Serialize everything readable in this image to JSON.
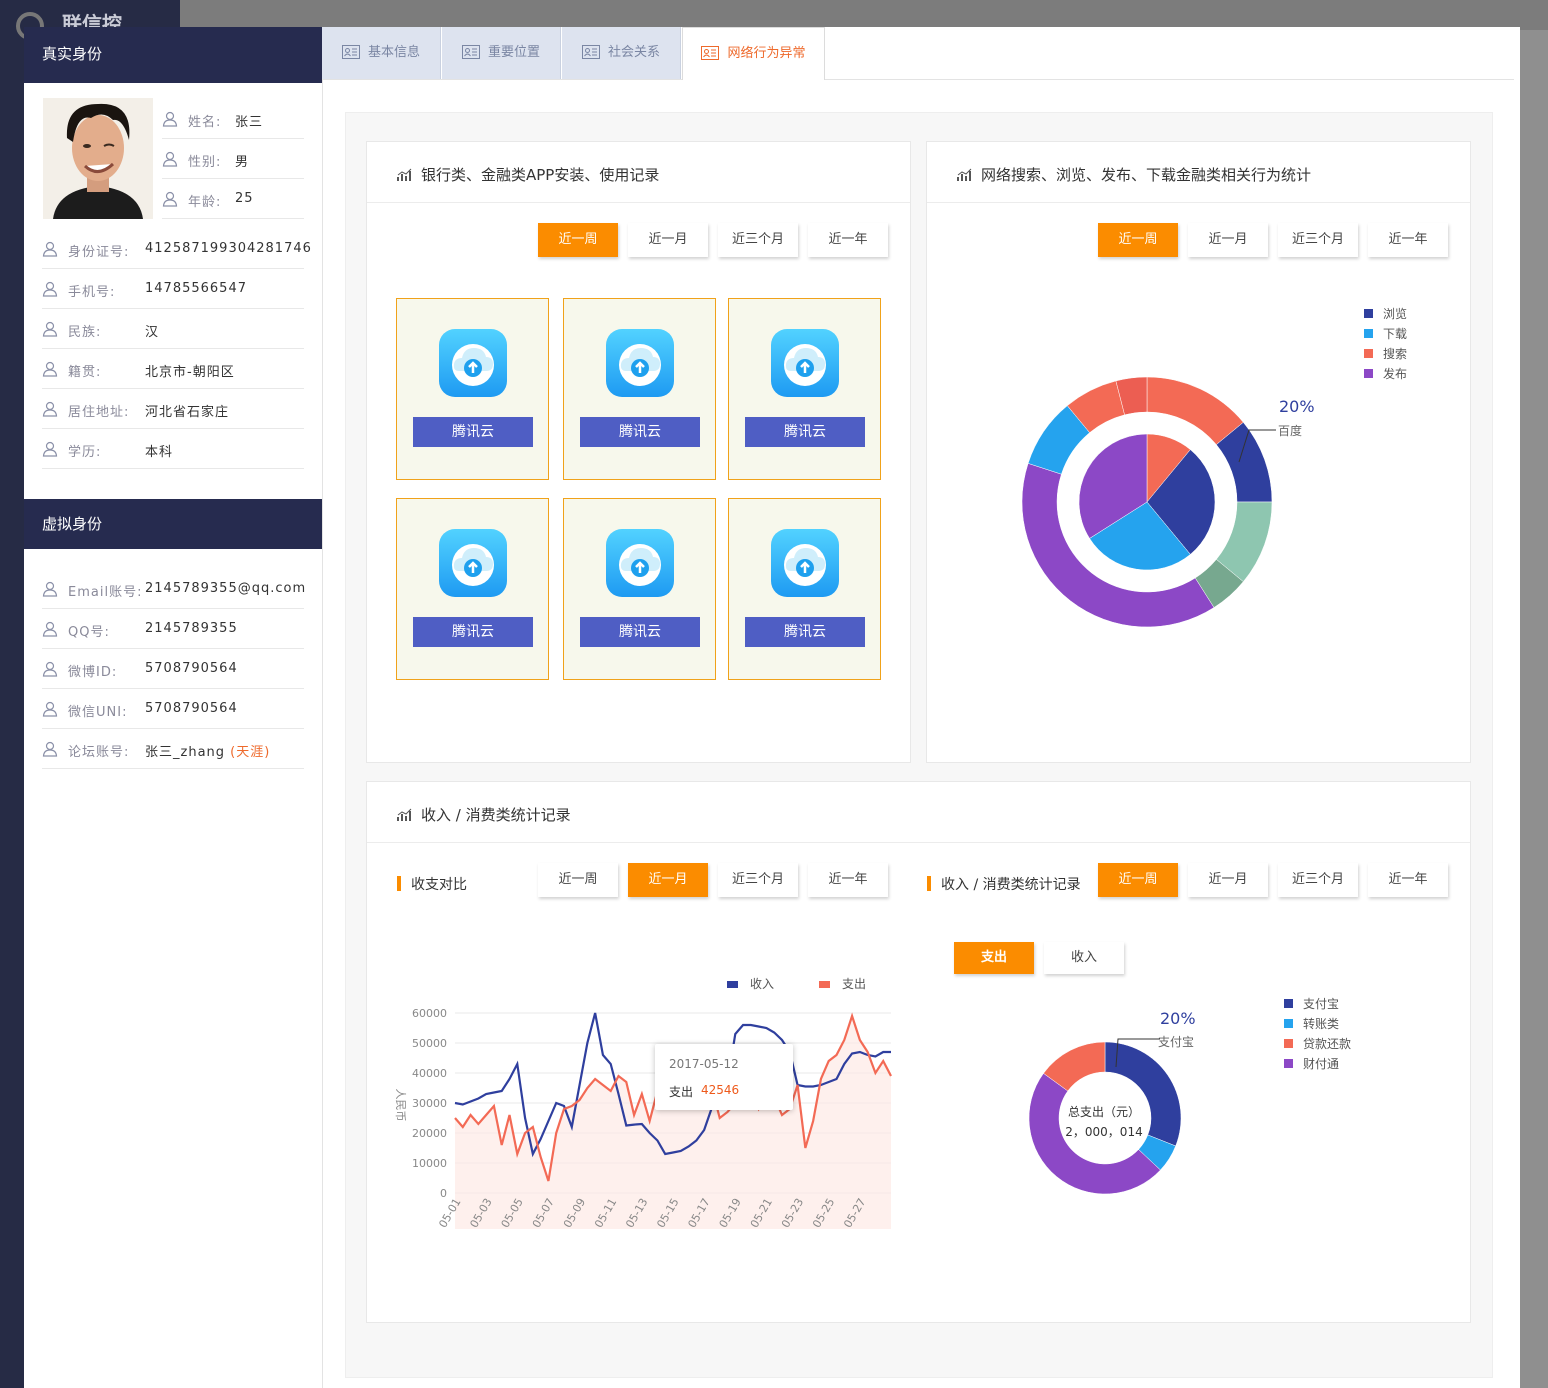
{
  "app": {
    "logo_text": "联信控"
  },
  "real_identity": {
    "section_title": "真实身份",
    "basic": [
      {
        "label": "姓名:",
        "value": "张三"
      },
      {
        "label": "性别:",
        "value": "男"
      },
      {
        "label": "年龄:",
        "value": "25"
      }
    ],
    "rows": [
      {
        "label": "身份证号:",
        "value": "412587199304281746"
      },
      {
        "label": "手机号:",
        "value": "14785566547"
      },
      {
        "label": "民族:",
        "value": "汉"
      },
      {
        "label": "籍贯:",
        "value": "北京市-朝阳区"
      },
      {
        "label": "居住地址:",
        "value": "河北省石家庄"
      },
      {
        "label": "学历:",
        "value": "本科"
      }
    ]
  },
  "virtual_identity": {
    "section_title": "虚拟身份",
    "rows": [
      {
        "label": "Email账号:",
        "value": "2145789355@qq.com"
      },
      {
        "label": "QQ号:",
        "value": "2145789355"
      },
      {
        "label": "微博ID:",
        "value": "5708790564"
      },
      {
        "label": "微信UNI:",
        "value": "5708790564"
      },
      {
        "label": "论坛账号:",
        "value": "张三_zhang",
        "tag": "(天涯)"
      }
    ]
  },
  "tabs": [
    {
      "label": "基本信息",
      "active": false
    },
    {
      "label": "重要位置",
      "active": false
    },
    {
      "label": "社会关系",
      "active": false
    },
    {
      "label": "网络行为异常",
      "active": true
    }
  ],
  "period_options": [
    "近一周",
    "近一月",
    "近三个月",
    "近一年"
  ],
  "bank_card": {
    "title": "银行类、金融类APP安装、使用记录",
    "active_period": "近一周",
    "apps": [
      "腾讯云",
      "腾讯云",
      "腾讯云",
      "腾讯云",
      "腾讯云",
      "腾讯云"
    ]
  },
  "search_card": {
    "title": "网络搜索、浏览、发布、下载金融类相关行为统计",
    "active_period": "近一周",
    "legend": [
      {
        "name": "浏览",
        "color": "#2f3f9e"
      },
      {
        "name": "下载",
        "color": "#25a3ee"
      },
      {
        "name": "搜索",
        "color": "#f36a55"
      },
      {
        "name": "发布",
        "color": "#8c48c6"
      }
    ],
    "callout_pct": "20%",
    "callout_label": "百度"
  },
  "income_card": {
    "title": "收入 / 消费类统计记录",
    "left_subtitle": "收支对比",
    "left_active_period": "近一月",
    "right_subtitle": "收入 / 消费类统计记录",
    "right_active_period": "近一周",
    "toggle": [
      {
        "label": "支出",
        "active": true
      },
      {
        "label": "收入",
        "active": false
      }
    ],
    "tooltip": {
      "date": "2017-05-12",
      "label": "支出",
      "value": "42546"
    },
    "donut_legend": [
      {
        "name": "支付宝",
        "color": "#2f3f9e"
      },
      {
        "name": "转账类",
        "color": "#25a3ee"
      },
      {
        "name": "贷款还款",
        "color": "#f36a55"
      },
      {
        "name": "财付通",
        "color": "#8c48c6"
      }
    ],
    "donut_callout_pct": "20%",
    "donut_callout_label": "支付宝",
    "donut_center_label": "总支出（元）",
    "donut_center_value": "2，000，014"
  },
  "chart_data": [
    {
      "type": "pie",
      "title": "",
      "inner_pie": [
        {
          "name": "搜索",
          "value": 11,
          "color": "#f36a55"
        },
        {
          "name": "浏览",
          "value": 28,
          "color": "#2f3f9e"
        },
        {
          "name": "下载",
          "value": 27,
          "color": "#25a3ee"
        },
        {
          "name": "发布",
          "value": 34,
          "color": "#8c48c6"
        }
      ],
      "outer_ring": [
        {
          "value": 14,
          "color": "#f36a55"
        },
        {
          "value": 11,
          "color": "#2f3f9e"
        },
        {
          "value": 11,
          "color": "#8ec6b0"
        },
        {
          "value": 5,
          "color": "#77a88f"
        },
        {
          "value": 39,
          "color": "#8c48c6"
        },
        {
          "value": 9,
          "color": "#25a3ee"
        },
        {
          "value": 7,
          "color": "#f36a55"
        },
        {
          "value": 4,
          "color": "#ec5e52"
        }
      ]
    },
    {
      "type": "area",
      "ylabel": "人民币",
      "ylim": [
        0,
        60000
      ],
      "yticks": [
        0,
        10000,
        20000,
        30000,
        40000,
        50000,
        60000
      ],
      "x": [
        "05-01",
        "05-01",
        "05-02",
        "05-02",
        "05-03",
        "05-03",
        "05-04",
        "05-04",
        "05-05",
        "05-05",
        "05-06",
        "05-06",
        "05-07",
        "05-07",
        "05-08",
        "05-08",
        "05-09",
        "05-09",
        "05-10",
        "05-10",
        "05-11",
        "05-11",
        "05-12",
        "05-12",
        "05-13",
        "05-13",
        "05-14",
        "05-14",
        "05-15",
        "05-15",
        "05-16",
        "05-16",
        "05-17",
        "05-17",
        "05-18",
        "05-18",
        "05-19",
        "05-19",
        "05-20",
        "05-20",
        "05-21",
        "05-21",
        "05-22",
        "05-22",
        "05-23",
        "05-23",
        "05-24",
        "05-24",
        "05-25",
        "05-25",
        "05-26",
        "05-26",
        "05-27",
        "05-27",
        "05-28",
        "05-28",
        "05-29"
      ],
      "xticks": [
        "05-01",
        "05-03",
        "05-05",
        "05-07",
        "05-09",
        "05-11",
        "05-13",
        "05-15",
        "05-17",
        "05-19",
        "05-21",
        "05-23",
        "05-25",
        "05-27"
      ],
      "series": [
        {
          "name": "收入",
          "color": "#2f3f9e",
          "values": [
            30000,
            29500,
            30500,
            31500,
            33000,
            33500,
            34000,
            38000,
            43000,
            25000,
            13000,
            18000,
            24000,
            30000,
            29000,
            22000,
            36000,
            50000,
            60000,
            46000,
            43000,
            33000,
            22500,
            22800,
            23000,
            20000,
            17500,
            13000,
            13500,
            14000,
            15500,
            17500,
            21000,
            28500,
            35000,
            37000,
            53000,
            56000,
            56000,
            55500,
            55000,
            53500,
            51000,
            47000,
            36000,
            35500,
            35500,
            36000,
            37000,
            38000,
            43000,
            46500,
            47000,
            46000,
            45500,
            47000,
            47000
          ]
        },
        {
          "name": "支出",
          "color": "#f36a55",
          "values": [
            25000,
            22000,
            26000,
            23000,
            26000,
            29000,
            16000,
            26000,
            13000,
            20000,
            22000,
            12000,
            4000,
            20000,
            28000,
            29000,
            31000,
            35000,
            38000,
            36000,
            34000,
            39000,
            37000,
            26000,
            33000,
            24000,
            34000,
            30000,
            29000,
            33000,
            34000,
            38000,
            42546,
            35000,
            25000,
            27000,
            30000,
            31000,
            34000,
            28000,
            33000,
            32000,
            26000,
            28000,
            36000,
            15000,
            24000,
            38000,
            44000,
            46000,
            51000,
            59000,
            51000,
            47000,
            40000,
            44000,
            39000
          ]
        }
      ]
    },
    {
      "type": "pie",
      "title": "",
      "slices": [
        {
          "name": "支付宝",
          "value": 31,
          "color": "#2f3f9e"
        },
        {
          "name": "转账类",
          "value": 6,
          "color": "#25a3ee"
        },
        {
          "name": "财付通",
          "value": 48,
          "color": "#8c48c6"
        },
        {
          "name": "贷款还款",
          "value": 15,
          "color": "#f36a55"
        }
      ]
    }
  ]
}
